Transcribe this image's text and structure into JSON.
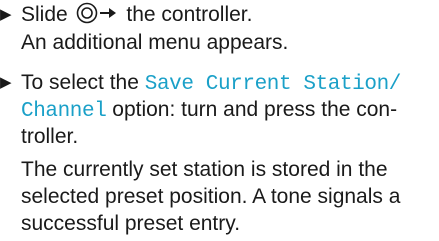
{
  "step1": {
    "bullet": "▶",
    "text_before": "Slide",
    "icon": "controller-slide-right-icon",
    "text_after": "the controller.",
    "result": "An additional menu appears."
  },
  "step2": {
    "bullet": "▶",
    "line1_text": "To select the",
    "option_part1": "Save Current Station/",
    "option_part2": "Channel",
    "line2_text": "option: turn and press the con-",
    "line3_text": "troller.",
    "result_line1": "The currently set station is stored in the",
    "result_line2": "selected preset position. A tone signals a",
    "result_line3": "successful preset entry."
  },
  "colors": {
    "text": "#1a1a1a",
    "option_highlight": "#1aa0c8"
  }
}
